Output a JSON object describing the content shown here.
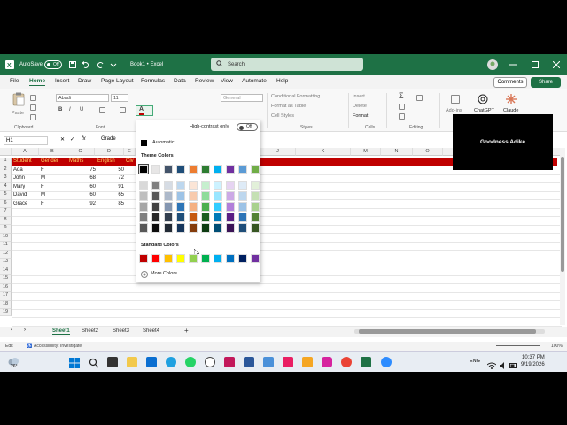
{
  "titlebar": {
    "autosave_label": "AutoSave",
    "autosave_state": "Off",
    "title": "Book1 • Excel",
    "search_placeholder": "Search"
  },
  "menu": {
    "tabs": [
      "File",
      "Home",
      "Insert",
      "Draw",
      "Page Layout",
      "Formulas",
      "Data",
      "Review",
      "View",
      "Automate",
      "Help"
    ],
    "active": "Home",
    "comments_label": "Comments",
    "share_label": "Share"
  },
  "ribbon": {
    "paste_label": "Paste",
    "clipboard_label": "Clipboard",
    "font_label": "Font",
    "font_name": "Abadi",
    "font_size": "11",
    "number_format": "General",
    "conditional_formatting": "Conditional Formatting",
    "format_as_table": "Format as Table",
    "cell_styles": "Cell Styles",
    "styles_label": "Styles",
    "insert_label": "Insert",
    "delete_label": "Delete",
    "format_label": "Format",
    "cells_label": "Cells",
    "editing_label": "Editing",
    "addins_label": "Add-ins",
    "chatgpt_label": "ChatGPT",
    "claude_label": "Claude"
  },
  "formula_bar": {
    "name_box": "H1",
    "fx": "fx",
    "content": "Grade"
  },
  "sheet": {
    "columns": [
      "A",
      "B",
      "C",
      "D",
      "E",
      "F",
      "G",
      "H",
      "I",
      "J",
      "K",
      "L",
      "M",
      "N",
      "O",
      "P",
      "Q",
      "R"
    ],
    "rows": [
      "1",
      "2",
      "3",
      "4",
      "5",
      "6",
      "7",
      "8",
      "9",
      "10",
      "11",
      "12",
      "13",
      "14",
      "15",
      "16",
      "17",
      "18",
      "19",
      "20"
    ],
    "header": [
      "Student",
      "Gender",
      "Maths",
      "English",
      "Civ"
    ],
    "data": [
      [
        "Ada",
        "F",
        "75",
        "50"
      ],
      [
        "John",
        "M",
        "68",
        "72"
      ],
      [
        "Mary",
        "F",
        "60",
        "91"
      ],
      [
        "David",
        "M",
        "60",
        "65"
      ],
      [
        "Grace",
        "F",
        "92",
        "85"
      ]
    ]
  },
  "color_popup": {
    "high_contrast_label": "High-contrast only",
    "high_contrast_state": "Off",
    "automatic_label": "Automatic",
    "theme_colors_label": "Theme Colors",
    "standard_colors_label": "Standard Colors",
    "more_colors_label": "More Colors...",
    "theme_top": [
      "#000000",
      "#e7e6e6",
      "#44546a",
      "#1f4e79",
      "#ed7d31",
      "#2e7d32",
      "#00b0f0",
      "#7030a0",
      "#5b9bd5",
      "#70ad47"
    ],
    "theme_columns": [
      [
        "#d9d9d9",
        "#bfbfbf",
        "#a6a6a6",
        "#808080",
        "#595959"
      ],
      [
        "#7f7f7f",
        "#595959",
        "#404040",
        "#262626",
        "#0d0d0d"
      ],
      [
        "#d6dce4",
        "#adb9ca",
        "#8496b0",
        "#333f4f",
        "#222a35"
      ],
      [
        "#bdd7ee",
        "#9dc3e6",
        "#2e75b6",
        "#1f4e79",
        "#16365c"
      ],
      [
        "#fbe5d6",
        "#f8cbad",
        "#f4b183",
        "#c55a11",
        "#843c0c"
      ],
      [
        "#c6efce",
        "#8fdc9a",
        "#4caf50",
        "#1b5e20",
        "#0d3b12"
      ],
      [
        "#ccf2ff",
        "#99e6ff",
        "#33ccff",
        "#007ab8",
        "#004e75"
      ],
      [
        "#e6d4f2",
        "#cca9e6",
        "#b17fd9",
        "#5a1f85",
        "#3b1457"
      ],
      [
        "#deebf7",
        "#bdd7ee",
        "#9dc3e6",
        "#2e75b6",
        "#1f4e79"
      ],
      [
        "#e2f0d9",
        "#c5e0b4",
        "#a9d18e",
        "#548235",
        "#375623"
      ]
    ],
    "standard": [
      "#c00000",
      "#ff0000",
      "#ffc000",
      "#ffff00",
      "#92d050",
      "#00b050",
      "#00b0f0",
      "#0070c0",
      "#002060",
      "#7030a0"
    ]
  },
  "sheets": {
    "tabs": [
      "Sheet1",
      "Sheet2",
      "Sheet3",
      "Sheet4"
    ],
    "active": "Sheet1",
    "add": "+"
  },
  "status": {
    "mode": "Edit",
    "accessibility": "Accessibility: Investigate",
    "zoom": "100%"
  },
  "video": {
    "name": "Goodness Adike"
  },
  "taskbar": {
    "weather": "26°",
    "lang": "ENG",
    "time": "10:37 PM",
    "date": "9/19/2026"
  }
}
